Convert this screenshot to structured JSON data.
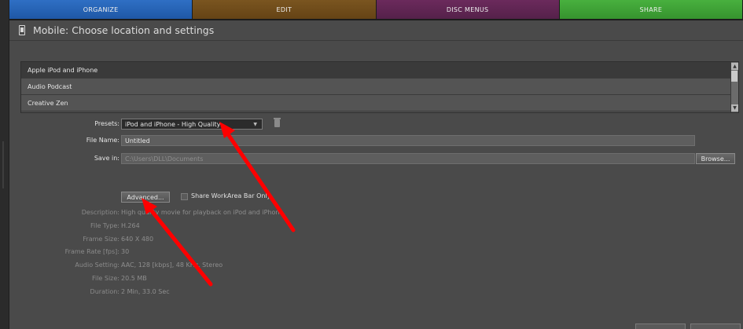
{
  "tabs": {
    "organize": "ORGANIZE",
    "edit": "EDIT",
    "disc_menus": "DISC MENUS",
    "share": "SHARE"
  },
  "panel": {
    "title": "Mobile: Choose location and settings"
  },
  "devices": {
    "items": [
      "Apple iPod and iPhone",
      "Audio Podcast",
      "Creative Zen"
    ],
    "selected": "Apple iPod and iPhone"
  },
  "form": {
    "presets_label": "Presets:",
    "presets_value": "iPod and iPhone - High Quality",
    "file_name_label": "File Name:",
    "file_name_value": "Untitled",
    "save_in_label": "Save in:",
    "save_in_value": "C:\\Users\\DLL\\Documents",
    "browse_label": "Browse...",
    "advanced_label": "Advanced...",
    "share_workarea_label": "Share WorkArea Bar Only",
    "share_workarea_checked": false
  },
  "info": {
    "description_label": "Description:",
    "description_value": "High quality movie for playback on iPod and iPhone.",
    "file_type_label": "File Type:",
    "file_type_value": "H.264",
    "frame_size_label": "Frame Size:",
    "frame_size_value": "640 X 480",
    "frame_rate_label": "Frame Rate [fps]:",
    "frame_rate_value": "30",
    "audio_label": "Audio Setting:",
    "audio_value": "AAC, 128 [kbps], 48 KHz, Stereo",
    "file_size_label": "File Size:",
    "file_size_value": "20.5 MB",
    "duration_label": "Duration:",
    "duration_value": "2 Min, 33.0 Sec"
  },
  "colors": {
    "organize_tab": "#2462b4",
    "edit_tab": "#6f4a1a",
    "disc_menus_tab": "#602552",
    "share_tab": "#3fa236",
    "annotation_arrow": "#ff0000"
  }
}
